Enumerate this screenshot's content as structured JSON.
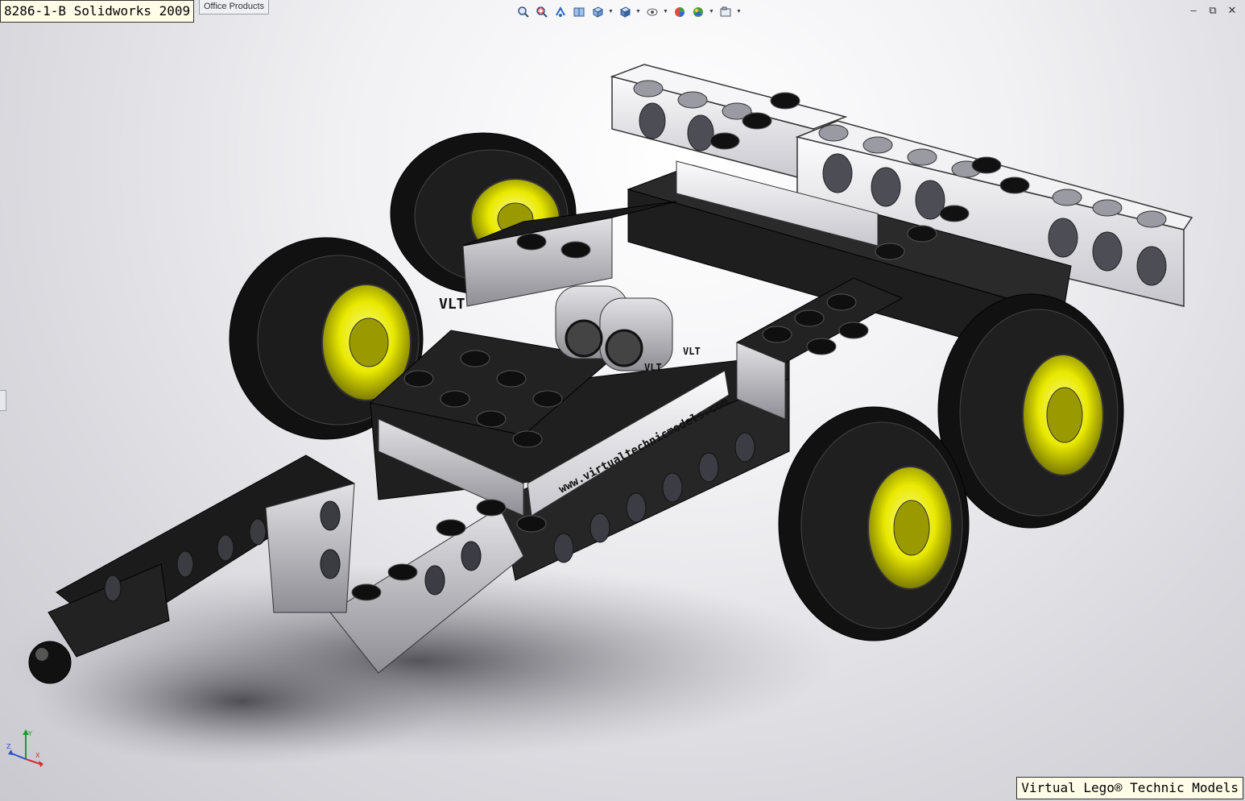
{
  "window": {
    "title": "8286-1-B Solidworks 2009",
    "office_tab": "Office Products",
    "controls": {
      "minimize": "–",
      "restore": "⧉",
      "close": "✕"
    }
  },
  "toolbar": {
    "icons": [
      "zoom-to-fit-icon",
      "zoom-area-icon",
      "previous-view-icon",
      "section-view-icon",
      "view-orientation-icon",
      "display-style-icon",
      "hide-show-items-icon",
      "edit-appearance-icon",
      "apply-scene-icon",
      "view-settings-icon"
    ]
  },
  "model": {
    "part_labels": [
      "VLT",
      "VLT",
      "VLT"
    ],
    "website": "www.virtualtechnicmodels.com"
  },
  "triad": {
    "x_label": "X",
    "y_label": "Y",
    "z_label": "Z"
  },
  "branding": "Virtual Lego® Technic Models",
  "colors": {
    "brick_black": "#1a1a1a",
    "brick_white": "#e8e8ec",
    "brick_gray": "#a7a7ad",
    "rim_yellow": "#e9e900",
    "tire_black": "#111111"
  }
}
